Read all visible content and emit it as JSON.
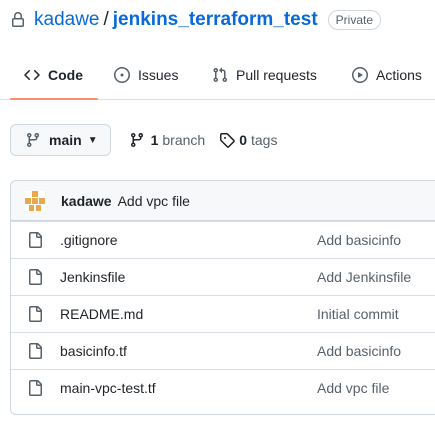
{
  "repo": {
    "owner": "kadawe",
    "separator": "/",
    "name": "jenkins_terraform_test",
    "visibility": "Private"
  },
  "nav": {
    "tabs": [
      {
        "label": "Code",
        "icon": "code-icon",
        "selected": true
      },
      {
        "label": "Issues",
        "icon": "issue-opened-icon",
        "selected": false
      },
      {
        "label": "Pull requests",
        "icon": "git-pull-request-icon",
        "selected": false
      },
      {
        "label": "Actions",
        "icon": "play-icon",
        "selected": false
      }
    ]
  },
  "branch": {
    "current": "main",
    "branch_count": "1",
    "branch_label": "branch",
    "tag_count": "0",
    "tag_label": "tags"
  },
  "latest_commit": {
    "author": "kadawe",
    "message": "Add vpc file"
  },
  "files": [
    {
      "name": ".gitignore",
      "commit": "Add basicinfo"
    },
    {
      "name": "Jenkinsfile",
      "commit": "Add Jenkinsfile"
    },
    {
      "name": "README.md",
      "commit": "Initial commit"
    },
    {
      "name": "basicinfo.tf",
      "commit": "Add basicinfo"
    },
    {
      "name": "main-vpc-test.tf",
      "commit": "Add vpc file"
    }
  ],
  "colors": {
    "link": "#0969da",
    "tab_underline": "#fd8c73",
    "avatar": "#e8a84e"
  }
}
